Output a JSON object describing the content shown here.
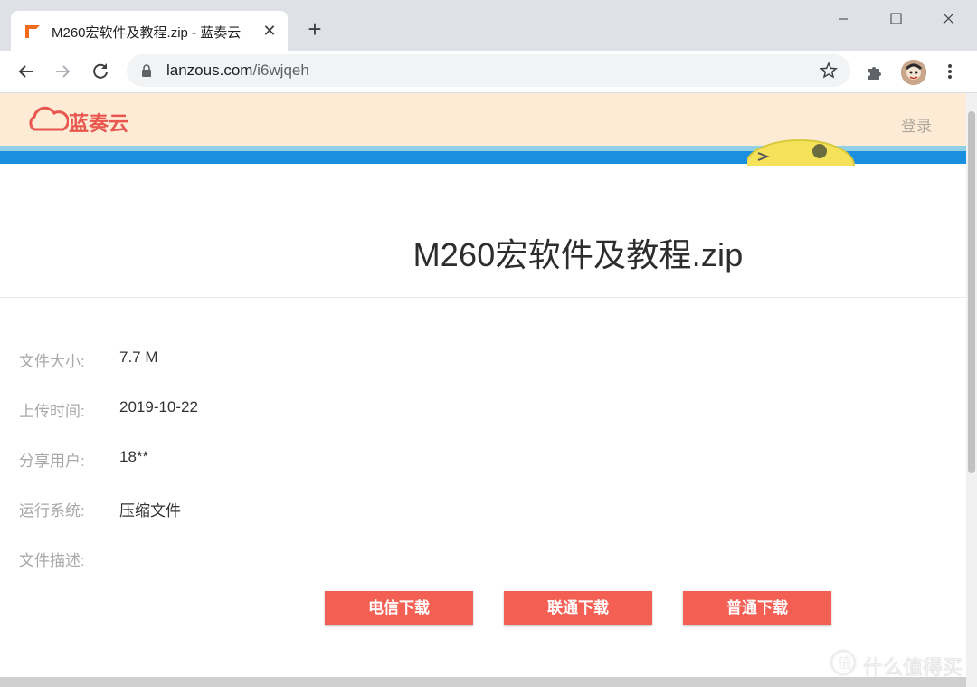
{
  "browser": {
    "tab_title": "M260宏软件及教程.zip - 蓝奏云",
    "url_domain": "lanzous.com",
    "url_path": "/i6wjqeh"
  },
  "site": {
    "logo_text": "蓝奏云",
    "login_label": "登录"
  },
  "file": {
    "name": "M260宏软件及教程.zip",
    "info": [
      {
        "label": "文件大小:",
        "value": "7.7 M"
      },
      {
        "label": "上传时间:",
        "value": "2019-10-22"
      },
      {
        "label": "分享用户:",
        "value": "18**"
      },
      {
        "label": "运行系统:",
        "value": "压缩文件"
      },
      {
        "label": "文件描述:",
        "value": ""
      }
    ]
  },
  "downloads": {
    "telecom": "电信下载",
    "unicom": "联通下载",
    "normal": "普通下载"
  },
  "watermark": {
    "text": "什么值得买"
  },
  "colors": {
    "accent": "#f36053",
    "header_bg": "#fdebd6",
    "banner_blue": "#1a8fe0"
  }
}
